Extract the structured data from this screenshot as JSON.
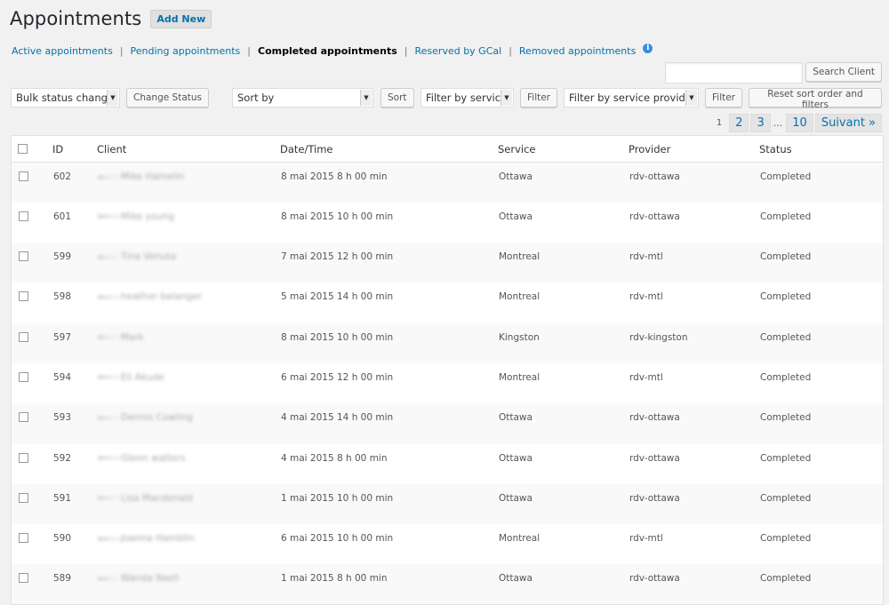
{
  "header": {
    "title": "Appointments",
    "add_new": "Add New"
  },
  "tabs": [
    {
      "label": "Active appointments",
      "current": false
    },
    {
      "label": "Pending appointments",
      "current": false
    },
    {
      "label": "Completed appointments",
      "current": true
    },
    {
      "label": "Reserved by GCal",
      "current": false
    },
    {
      "label": "Removed appointments",
      "current": false
    }
  ],
  "search": {
    "button": "Search Client",
    "value": ""
  },
  "toolbar": {
    "bulk_select": "Bulk status change",
    "change_status": "Change Status",
    "sort_select": "Sort by",
    "sort_button": "Sort",
    "service_select": "Filter by service",
    "filter_button": "Filter",
    "provider_select": "Filter by service provider",
    "filter_button2": "Filter",
    "reset_button": "Reset sort order and filters"
  },
  "pagination": {
    "current": "1",
    "pages": [
      "2",
      "3"
    ],
    "dots": "...",
    "last": "10",
    "next": "Suivant »"
  },
  "table": {
    "columns": {
      "id": "ID",
      "client": "Client",
      "datetime": "Date/Time",
      "service": "Service",
      "provider": "Provider",
      "status": "Status"
    },
    "rows": [
      {
        "id": "602",
        "client": "Mike Hamelin",
        "datetime": "8 mai 2015 8 h 00 min",
        "service": "Ottawa",
        "provider": "rdv-ottawa",
        "status": "Completed"
      },
      {
        "id": "601",
        "client": "Mike young",
        "datetime": "8 mai 2015 10 h 00 min",
        "service": "Ottawa",
        "provider": "rdv-ottawa",
        "status": "Completed"
      },
      {
        "id": "599",
        "client": "Tina Venuta",
        "datetime": "7 mai 2015 12 h 00 min",
        "service": "Montreal",
        "provider": "rdv-mtl",
        "status": "Completed"
      },
      {
        "id": "598",
        "client": "heather belanger",
        "datetime": "5 mai 2015 14 h 00 min",
        "service": "Montreal",
        "provider": "rdv-mtl",
        "status": "Completed"
      },
      {
        "id": "597",
        "client": "Mark",
        "datetime": "8 mai 2015 10 h 00 min",
        "service": "Kingston",
        "provider": "rdv-kingston",
        "status": "Completed"
      },
      {
        "id": "594",
        "client": "Eli Akude",
        "datetime": "6 mai 2015 12 h 00 min",
        "service": "Montreal",
        "provider": "rdv-mtl",
        "status": "Completed"
      },
      {
        "id": "593",
        "client": "Dennis Cowling",
        "datetime": "4 mai 2015 14 h 00 min",
        "service": "Ottawa",
        "provider": "rdv-ottawa",
        "status": "Completed"
      },
      {
        "id": "592",
        "client": "Glenn walters",
        "datetime": "4 mai 2015 8 h 00 min",
        "service": "Ottawa",
        "provider": "rdv-ottawa",
        "status": "Completed"
      },
      {
        "id": "591",
        "client": "Lisa Macdonald",
        "datetime": "1 mai 2015 10 h 00 min",
        "service": "Ottawa",
        "provider": "rdv-ottawa",
        "status": "Completed"
      },
      {
        "id": "590",
        "client": "Joanna Hamblin",
        "datetime": "6 mai 2015 10 h 00 min",
        "service": "Montreal",
        "provider": "rdv-mtl",
        "status": "Completed"
      },
      {
        "id": "589",
        "client": "Wanda Nash",
        "datetime": "1 mai 2015 8 h 00 min",
        "service": "Ottawa",
        "provider": "rdv-ottawa",
        "status": "Completed"
      }
    ]
  }
}
